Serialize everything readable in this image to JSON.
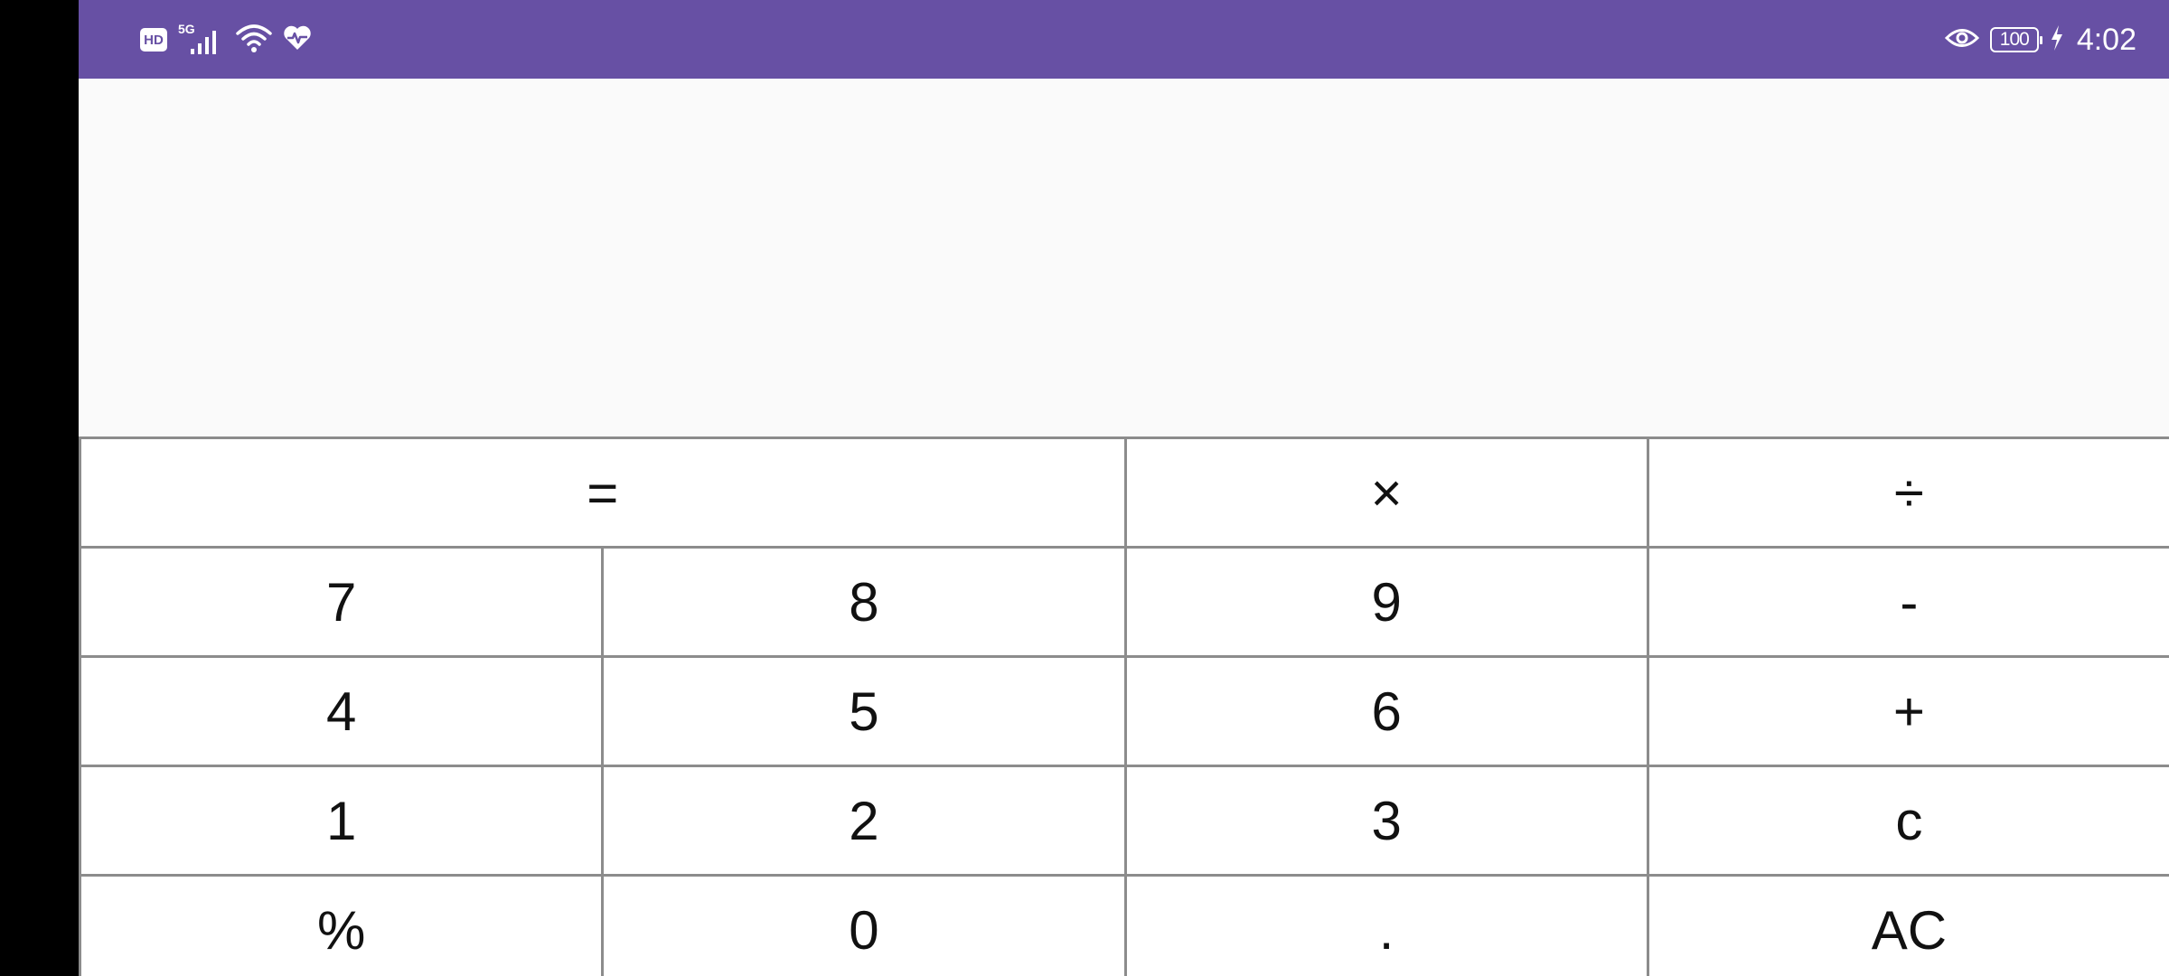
{
  "status_bar": {
    "hd_label": "HD",
    "network_label": "5G",
    "battery_level": "100",
    "time": "4:02",
    "icons": [
      "hd-icon",
      "signal-icon",
      "wifi-icon",
      "health-icon",
      "eye-icon",
      "battery-icon",
      "charging-icon"
    ],
    "background_color": "#6750a4"
  },
  "display": {
    "expression": "",
    "result": ""
  },
  "keypad": {
    "row1": [
      "=",
      "×",
      "÷"
    ],
    "row2": [
      "7",
      "8",
      "9",
      "-"
    ],
    "row3": [
      "4",
      "5",
      "6",
      "+"
    ],
    "row4": [
      "1",
      "2",
      "3",
      "c"
    ],
    "row5": [
      "%",
      "0",
      ".",
      "AC"
    ]
  }
}
